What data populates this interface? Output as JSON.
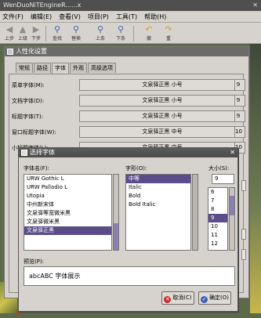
{
  "app": {
    "title": "WenDuoNiTEngineR......x",
    "close_glyph": "✕"
  },
  "menubar": [
    "文件(F)",
    "编辑(E)",
    "查看(V)",
    "项目(P)",
    "工具(T)",
    "帮助(H)"
  ],
  "toolbar": {
    "back": "上步",
    "up": "上级",
    "forward": "下步",
    "search": "查找",
    "find2": "替换",
    "prev": "上条",
    "next": "下条",
    "undo": "撤",
    "redo": "重"
  },
  "prefs": {
    "title": "人性化设置",
    "tabs": [
      "常规",
      "路径",
      "字体",
      "外观",
      "高级选项"
    ],
    "rows": [
      {
        "label": "菜单字体(M):",
        "value": "文泉驿正黑 小号",
        "size": "9"
      },
      {
        "label": "文档字体(D):",
        "value": "文泉驿正黑 小号",
        "size": "9"
      },
      {
        "label": "标题字体(T):",
        "value": "文泉驿正黑 小号",
        "size": "9"
      },
      {
        "label": "窗口标题字体(W):",
        "value": "文泉驿正黑 中号",
        "size": "10"
      },
      {
        "label": "小标题字体(L):",
        "value": "文泉驿正黑 中号",
        "size": "10"
      }
    ]
  },
  "font_dialog": {
    "title": "选择字体",
    "family_label": "字体名(F):",
    "style_label": "字形(O):",
    "size_label": "大小(S):",
    "families": [
      "URW Gothic L",
      "URW Palladio L",
      "Utopia",
      "中州新宋体",
      "文泉驿等宽微米黑",
      "文泉驿微米黑",
      "文泉驿正黑"
    ],
    "selected_family": 6,
    "styles": [
      "中等",
      "Italic",
      "Bold",
      "Bold Italic"
    ],
    "selected_style": 0,
    "size_value": "9",
    "sizes": [
      "6",
      "7",
      "8",
      "9",
      "10",
      "11",
      "12"
    ],
    "selected_size": 3,
    "preview_label": "预览(P):",
    "preview_text": "abcABC 字体展示",
    "cancel": "取消(C)",
    "ok": "确定(O)"
  },
  "colors": {
    "selection": "#5a4d8a",
    "accent": "#3a62b5"
  }
}
